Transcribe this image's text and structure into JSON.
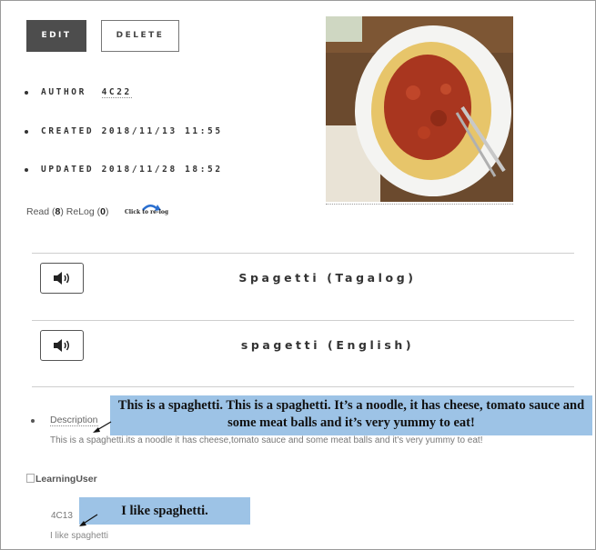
{
  "actions": {
    "edit_label": "EDIT",
    "delete_label": "DELETE"
  },
  "meta": {
    "author_label": "AUTHOR",
    "author_value": "4C22",
    "created_label": "CREATED",
    "created_value": "2018/11/13 11:55",
    "updated_label": "UPDATED",
    "updated_value": "2018/11/28 18:52"
  },
  "stats": {
    "read_label": "Read",
    "read_count": "8",
    "relog_label": "ReLog",
    "relog_count": "0",
    "relog_link": "Click to re-log"
  },
  "words": [
    {
      "text": "Spagetti (Tagalog)",
      "icon": "speaker-icon"
    },
    {
      "text": "spagetti (English)",
      "icon": "speaker-icon"
    }
  ],
  "description": {
    "label": "Description",
    "text": "This is a spaghetti.its a noodle it has cheese,tomato sauce and some meat balls and it's very yummy to eat!"
  },
  "annotations": {
    "description_callout": "This is a spaghetti. This is a spaghetti. It’s a noodle, it has cheese, tomato sauce and some meat balls and it’s very yummy to eat!",
    "comment_callout": "I like spaghetti."
  },
  "comment": {
    "user_image_alt": "LearningUser",
    "user_id": "4C13",
    "text": "I like spaghetti"
  },
  "colors": {
    "callout_bg": "#9dc3e6",
    "edit_bg": "#4d4d4d"
  }
}
